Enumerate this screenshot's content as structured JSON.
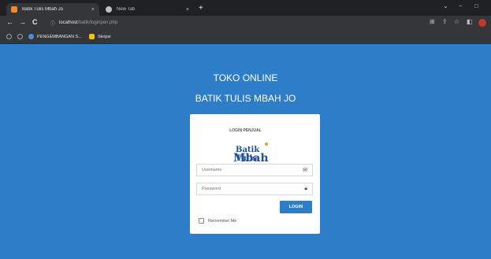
{
  "browser": {
    "tabs": [
      {
        "label": "Batik Tulis Mbah Jo",
        "close": "×",
        "icon_color": "#f0892b"
      },
      {
        "label": "New Tab",
        "close": "×",
        "icon_color": "#bdc1c6"
      }
    ],
    "new_tab": "+",
    "window_controls": {
      "dropdown": "⌄",
      "minimize": "−",
      "maximize": "□"
    },
    "nav": {
      "back": "←",
      "forward": "→",
      "reload": "C"
    },
    "address": {
      "info": "ⓘ",
      "host": "localhost",
      "path": "/batik/loginpen.php"
    },
    "toolbar_icons": {
      "translate": "⊞",
      "share": "⇪",
      "star": "☆",
      "sidebar": "◧"
    },
    "bookmarks": [
      {
        "label": "PENGEMBANGAN S...",
        "icon_color": "#4a90d9"
      },
      {
        "label": "Skripsi",
        "icon_color": "#f4c20d"
      }
    ]
  },
  "page": {
    "heading1": "TOKO ONLINE",
    "heading2": "BATIK TULIS MBAH JO",
    "background": "#2e7dc9",
    "login": {
      "title": "LOGIN PENJUAL",
      "logo_line1": "Batik Tulis",
      "logo_line2": "Mbah Jo",
      "username_placeholder": "Username",
      "password_placeholder": "Password",
      "button": "LOGIN",
      "remember": "Remember Me"
    }
  }
}
